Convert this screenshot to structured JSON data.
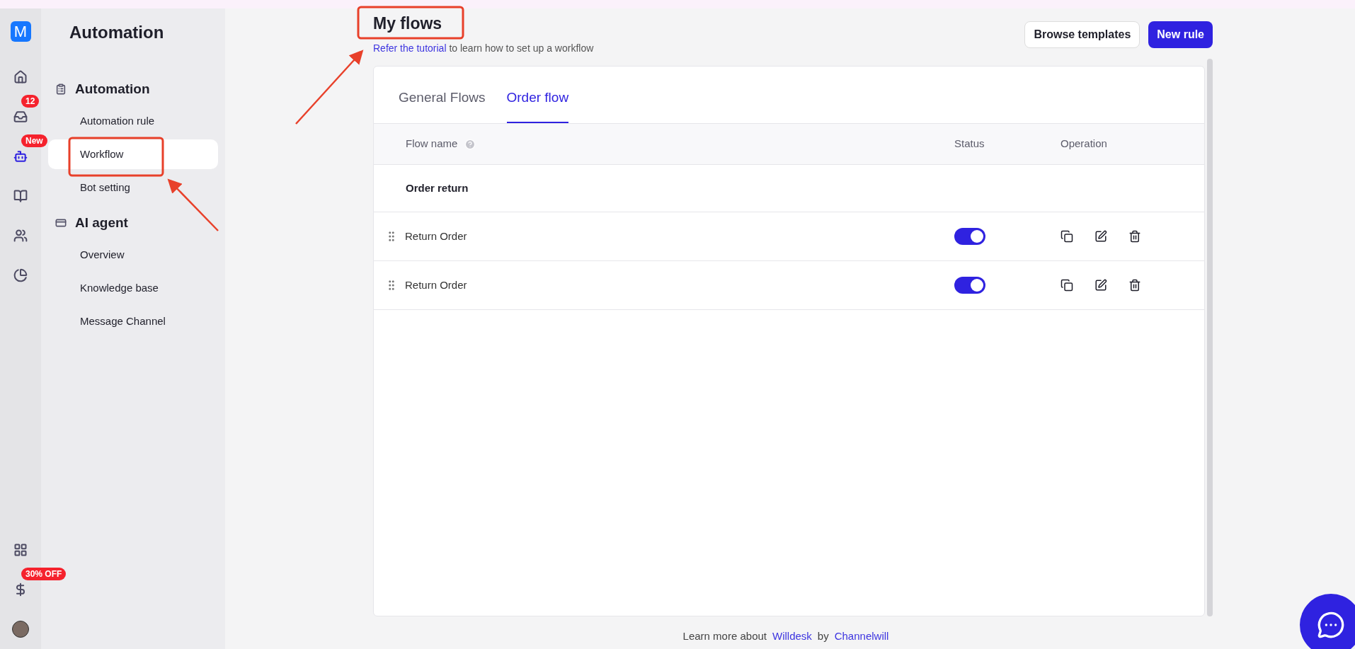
{
  "rail": {
    "logo": "M",
    "items": [
      {
        "kind": "home",
        "selected": false
      },
      {
        "kind": "inbox",
        "selected": false,
        "badge": "12"
      },
      {
        "kind": "bot",
        "selected": true,
        "badge": "New"
      },
      {
        "kind": "book",
        "selected": false
      },
      {
        "kind": "users",
        "selected": false
      },
      {
        "kind": "chart",
        "selected": false
      }
    ],
    "bottom": [
      {
        "kind": "apps"
      },
      {
        "kind": "dollar",
        "badge": "30% OFF"
      },
      {
        "kind": "avatar"
      }
    ]
  },
  "sidebar": {
    "title": "Automation",
    "sections": [
      {
        "kind": "automation",
        "title": "Automation",
        "items": [
          {
            "label": "Automation rule",
            "selected": false
          },
          {
            "label": "Workflow",
            "selected": true
          },
          {
            "label": "Bot setting",
            "selected": false
          }
        ]
      },
      {
        "kind": "agent",
        "title": "AI agent",
        "items": [
          {
            "label": "Overview",
            "selected": false
          },
          {
            "label": "Knowledge base",
            "selected": false
          },
          {
            "label": "Message Channel",
            "selected": false
          }
        ]
      }
    ]
  },
  "header": {
    "title": "My flows",
    "subtitle_link": "Refer the tutorial",
    "subtitle_text": "to learn how to set up a workflow",
    "buttons": [
      {
        "label": "Browse templates",
        "kind": "secondary"
      },
      {
        "label": "New rule",
        "kind": "primary"
      }
    ]
  },
  "tabs": [
    {
      "label": "General Flows",
      "selected": false
    },
    {
      "label": "Order flow",
      "selected": true
    }
  ],
  "table": {
    "columns": [
      "Flow name",
      "Status",
      "Operation"
    ],
    "groups": [
      {
        "name": "Order return",
        "rows": [
          {
            "name": "Return Order",
            "on": true
          },
          {
            "name": "Return Order",
            "on": true
          }
        ]
      }
    ]
  },
  "footer": {
    "prefix": "Learn more about",
    "link1": "Willdesk",
    "by": "by",
    "link2": "Channelwill"
  }
}
